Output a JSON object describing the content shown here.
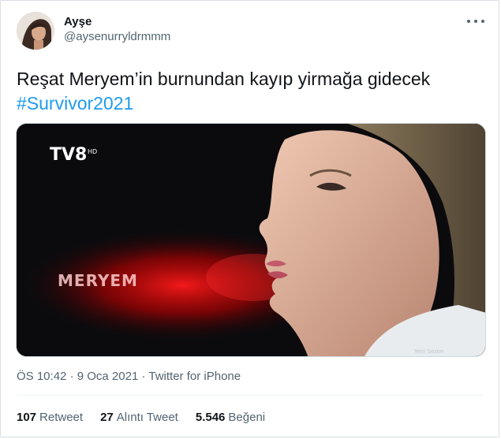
{
  "author": {
    "display_name": "Ayşe",
    "handle": "@aysenurryldrmmm"
  },
  "tweet": {
    "text_line1": "Reşat Meryem’in burnundan kayıp yirmağa gidecek",
    "hashtag": "#Survivor2021"
  },
  "media": {
    "channel_logo": "TV8",
    "channel_logo_suffix": "HD",
    "overlay_text": "MERYEM",
    "corner_caption": "Yeni Sezon"
  },
  "meta": {
    "time": "ÖS 10:42",
    "separator": "·",
    "date": "9 Oca 2021",
    "source": "Twitter for iPhone"
  },
  "stats": {
    "retweets_count": "107",
    "retweets_label": "Retweet",
    "quotes_count": "27",
    "quotes_label": "Alıntı Tweet",
    "likes_count": "5.546",
    "likes_label": "Beğeni"
  },
  "colors": {
    "link": "#1d9bf0",
    "secondary_text": "#536471",
    "primary_text": "#0f1419"
  }
}
